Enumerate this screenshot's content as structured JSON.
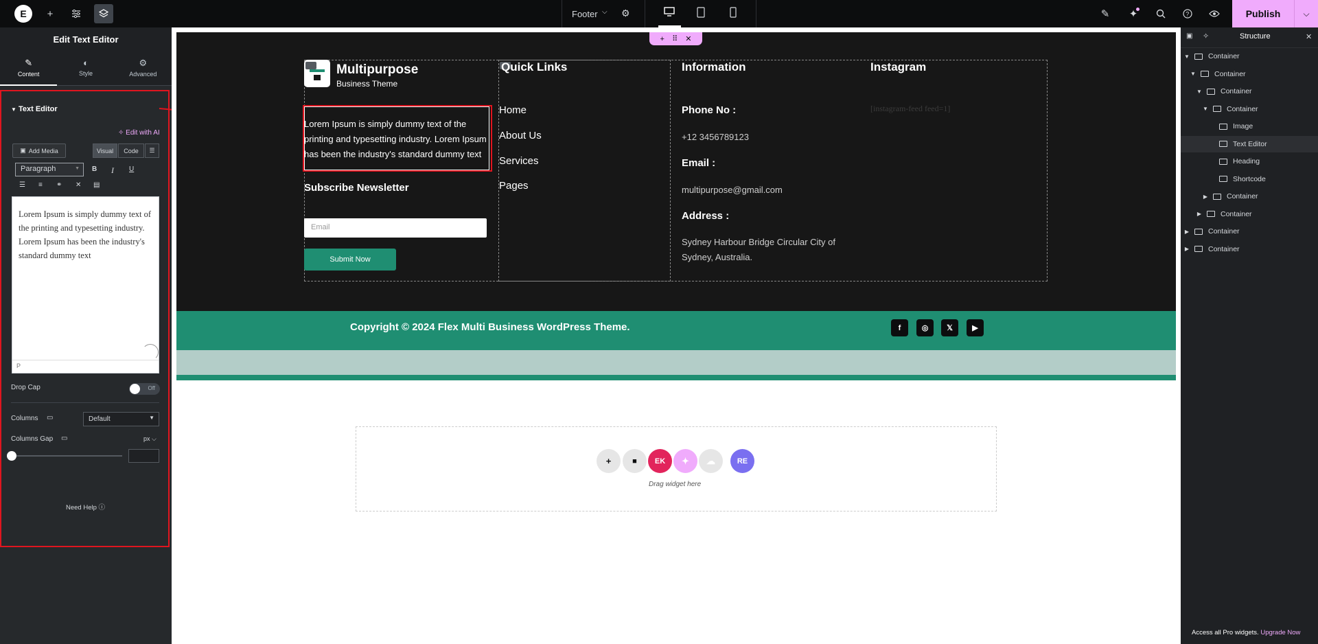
{
  "topbar": {
    "document_name": "Footer",
    "publish_label": "Publish"
  },
  "left_panel": {
    "title": "Edit Text Editor",
    "tabs": [
      {
        "label": "Content",
        "icon": "pencil-icon"
      },
      {
        "label": "Style",
        "icon": "half-circle-icon"
      },
      {
        "label": "Advanced",
        "icon": "gear-icon"
      }
    ],
    "section_title": "Text Editor",
    "edit_with_ai": "Edit with AI",
    "add_media": "Add Media",
    "visual_tab": "Visual",
    "code_tab": "Code",
    "format_select": "Paragraph",
    "editor_content": "Lorem Ipsum is simply dummy text of the printing and typesetting industry. Lorem Ipsum has been the industry's standard dummy text",
    "editor_footer": "P",
    "drop_cap_label": "Drop Cap",
    "drop_cap_state": "Off",
    "columns_label": "Columns",
    "columns_value": "Default",
    "columns_gap_label": "Columns Gap",
    "columns_gap_unit": "px",
    "need_help": "Need Help"
  },
  "canvas": {
    "brand_name": "Multipurpose",
    "brand_sub": "Business Theme",
    "lorem": "Lorem Ipsum is simply dummy text of the printing and typesetting industry. Lorem Ipsum has been the industry's standard dummy text",
    "subscribe_heading": "Subscribe Newsletter",
    "email_placeholder": "Email",
    "submit_label": "Submit Now",
    "quick_links_heading": "Quick Links",
    "quick_links": [
      "Home",
      "About Us",
      "Services",
      "Pages"
    ],
    "information_heading": "Information",
    "phone_label": "Phone No :",
    "phone_value": "+12 3456789123",
    "email_label": "Email :",
    "email_value": "multipurpose@gmail.com",
    "address_label": "Address :",
    "address_value": "Sydney Harbour Bridge Circular City of Sydney, Australia.",
    "instagram_heading": "Instagram",
    "instagram_shortcode": "[instagram-feed feed=1]",
    "copyright": "Copyright © 2024 Flex Multi Business WordPress Theme.",
    "drag_widget": "Drag widget here"
  },
  "structure_panel": {
    "title": "Structure",
    "items": [
      {
        "label": "Container",
        "depth": 0,
        "caret": "down"
      },
      {
        "label": "Container",
        "depth": 1,
        "caret": "down"
      },
      {
        "label": "Container",
        "depth": 2,
        "caret": "down"
      },
      {
        "label": "Container",
        "depth": 3,
        "caret": "down"
      },
      {
        "label": "Image",
        "depth": 4,
        "caret": ""
      },
      {
        "label": "Text Editor",
        "depth": 4,
        "caret": "",
        "selected": true
      },
      {
        "label": "Heading",
        "depth": 4,
        "caret": ""
      },
      {
        "label": "Shortcode",
        "depth": 4,
        "caret": ""
      },
      {
        "label": "Container",
        "depth": 3,
        "caret": "right"
      },
      {
        "label": "Container",
        "depth": 2,
        "caret": "right"
      },
      {
        "label": "Container",
        "depth": 0,
        "caret": "right"
      },
      {
        "label": "Container",
        "depth": 0,
        "caret": "right"
      }
    ],
    "promo_text": "Access all Pro widgets.",
    "promo_link": "Upgrade Now"
  },
  "colors": {
    "accent_pink": "#f0abfc",
    "brand_green": "#1f8e72",
    "highlight_red": "#e0151f",
    "panel_dark": "#26292c"
  }
}
